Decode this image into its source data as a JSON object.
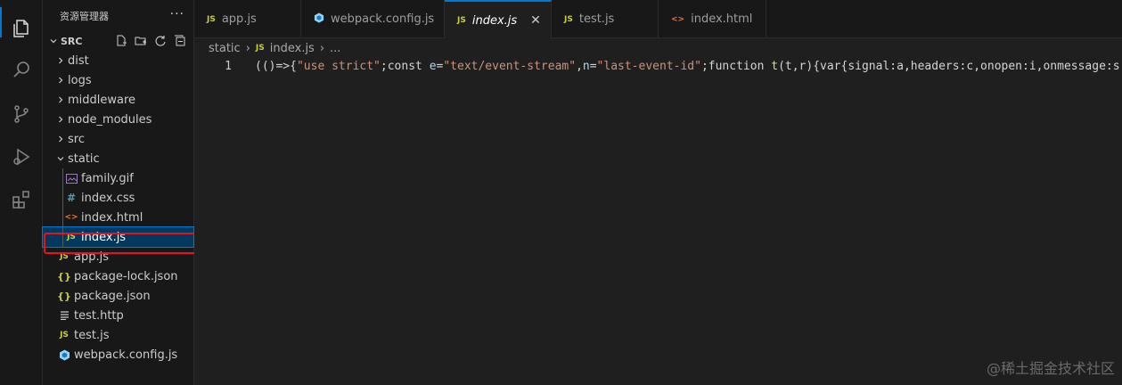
{
  "explorer": {
    "title": "资源管理器",
    "more": "···",
    "section": "SRC",
    "items": [
      {
        "label": "dist",
        "icon": "chevron-right-icon"
      },
      {
        "label": "logs",
        "icon": "chevron-right-icon"
      },
      {
        "label": "middleware",
        "icon": "chevron-right-icon"
      },
      {
        "label": "node_modules",
        "icon": "chevron-right-icon"
      },
      {
        "label": "src",
        "icon": "chevron-right-icon"
      },
      {
        "label": "static",
        "icon": "chevron-down-icon"
      },
      {
        "label": "family.gif",
        "icon": "image-file-icon"
      },
      {
        "label": "index.css",
        "icon_text": "#"
      },
      {
        "label": "index.html",
        "icon_text": "<>"
      },
      {
        "label": "index.js",
        "icon_text": "JS",
        "selected": true
      },
      {
        "label": "app.js",
        "icon_text": "JS"
      },
      {
        "label": "package-lock.json",
        "icon_text": "{}"
      },
      {
        "label": "package.json",
        "icon_text": "{}"
      },
      {
        "label": "test.http",
        "icon": "lines-file-icon"
      },
      {
        "label": "test.js",
        "icon_text": "JS"
      },
      {
        "label": "webpack.config.js",
        "icon": "webpack-icon"
      }
    ]
  },
  "tabs": [
    {
      "label": "app.js",
      "icon_text": "JS"
    },
    {
      "label": "webpack.config.js",
      "icon": "webpack-icon"
    },
    {
      "label": "index.js",
      "icon_text": "JS",
      "active": true,
      "close": "✕"
    },
    {
      "label": "test.js",
      "icon_text": "JS"
    },
    {
      "label": "index.html",
      "icon_text": "<>"
    }
  ],
  "breadcrumb": {
    "folder": "static",
    "file": "index.js",
    "more": "...",
    "file_icon_text": "JS"
  },
  "editor": {
    "line_number": "1",
    "tokens": [
      {
        "t": "(()=>{",
        "c": "plain"
      },
      {
        "t": "\"use strict\"",
        "c": "str"
      },
      {
        "t": ";const ",
        "c": "plain"
      },
      {
        "t": "e",
        "c": "var"
      },
      {
        "t": "=",
        "c": "plain"
      },
      {
        "t": "\"text/event-stream\"",
        "c": "str"
      },
      {
        "t": ",",
        "c": "plain"
      },
      {
        "t": "n",
        "c": "var"
      },
      {
        "t": "=",
        "c": "plain"
      },
      {
        "t": "\"last-event-id\"",
        "c": "str"
      },
      {
        "t": ";function ",
        "c": "plain"
      },
      {
        "t": "t",
        "c": "fn"
      },
      {
        "t": "(t,r){var{signal:a,headers:c,onopen:i,onmessage:s,onclose:o,onerror:u}",
        "c": "plain"
      }
    ]
  },
  "watermark": "@稀土掘金技术社区",
  "colors": {
    "accent": "#0078d4",
    "highlight_box": "#e81123",
    "selected_bg": "#04395e"
  }
}
